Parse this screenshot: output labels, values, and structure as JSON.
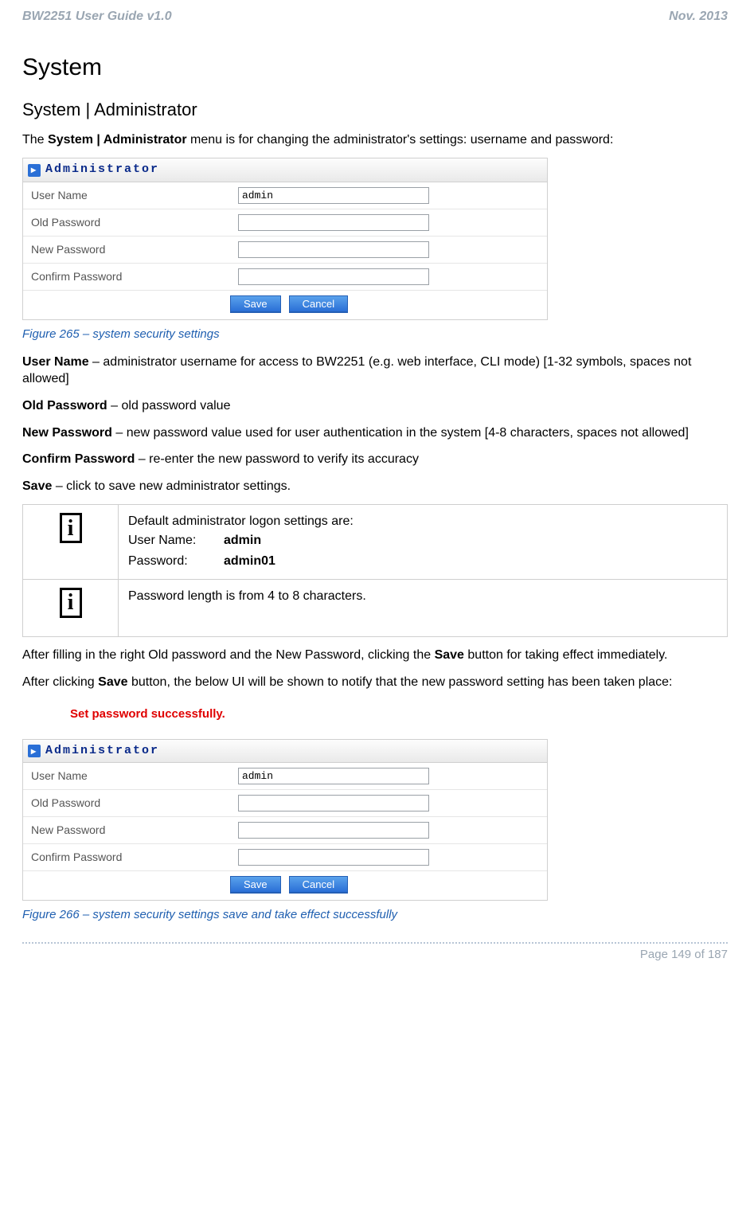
{
  "header": {
    "left": "BW2251 User Guide v1.0",
    "right": "Nov.  2013"
  },
  "headings": {
    "h1": "System",
    "h2": "System | Administrator"
  },
  "intro": {
    "prefix": "The ",
    "bold": "System | Administrator",
    "suffix": " menu is for changing the administrator's settings: username and password:"
  },
  "panel1": {
    "title": "Administrator",
    "rows": {
      "user_name_label": "User Name",
      "user_name_value": "admin",
      "old_pw_label": "Old Password",
      "old_pw_value": "",
      "new_pw_label": "New Password",
      "new_pw_value": "",
      "confirm_pw_label": "Confirm Password",
      "confirm_pw_value": ""
    },
    "buttons": {
      "save": "Save",
      "cancel": "Cancel"
    }
  },
  "fig1": "Figure 265 – system security settings",
  "desc": {
    "user_name_b": "User Name",
    "user_name_t": " – administrator username for access to BW2251 (e.g. web interface, CLI mode) [1-32 symbols, spaces not allowed]",
    "old_pw_b": "Old Password",
    "old_pw_t": " – old password value",
    "new_pw_b": "New Password",
    "new_pw_t": " – new password value used for user authentication in the system [4-8 characters, spaces not allowed]",
    "confirm_pw_b": "Confirm Password",
    "confirm_pw_t": " – re-enter the new password to verify its accuracy",
    "save_b": "Save",
    "save_t": " – click to save new administrator settings."
  },
  "info1": {
    "line1": "Default administrator logon settings are:",
    "user_k": "User Name:",
    "user_v": "admin",
    "pass_k": "Password:",
    "pass_v": "admin01"
  },
  "info2": "Password length is from 4 to 8 characters.",
  "after1_pre": "After filling in the right Old password and the New Password, clicking the ",
  "after1_b": "Save",
  "after1_post": " button for taking effect immediately.",
  "after2_pre": "After clicking ",
  "after2_b": "Save",
  "after2_post": " button, the below UI will be shown to notify that the new password setting has been taken place:",
  "success": "Set password successfully.",
  "panel2": {
    "title": "Administrator",
    "rows": {
      "user_name_label": "User Name",
      "user_name_value": "admin",
      "old_pw_label": "Old Password",
      "old_pw_value": "",
      "new_pw_label": "New Password",
      "new_pw_value": "",
      "confirm_pw_label": "Confirm Password",
      "confirm_pw_value": ""
    },
    "buttons": {
      "save": "Save",
      "cancel": "Cancel"
    }
  },
  "fig2": "Figure 266 – system security settings save and take effect successfully",
  "footer": "Page 149 of 187"
}
